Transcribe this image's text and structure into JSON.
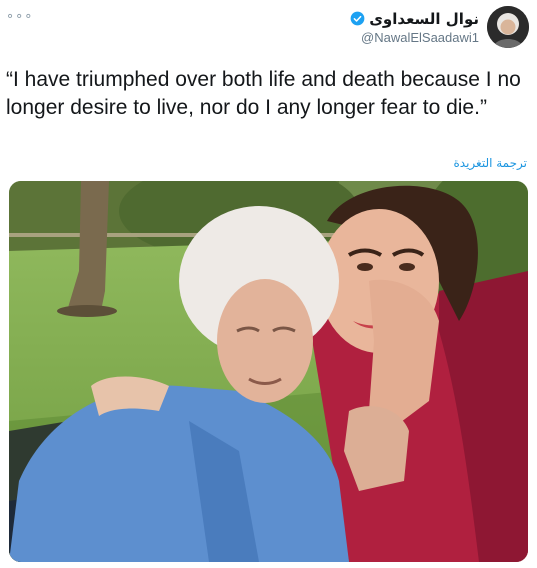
{
  "tweet": {
    "more_label": "∘∘∘",
    "author": {
      "display_name": "نوال السعداوى",
      "handle": "@NawalElSaadawi1",
      "verified": true,
      "avatar_icon": "profile-photo"
    },
    "text": "“I have triumphed over both life and death because I no longer desire to live, nor do I any longer fear to die.”",
    "translate_label": "ترجمة التغريدة",
    "media": {
      "type": "photo"
    },
    "colors": {
      "link": "#1b95e0",
      "verified_badge": "#1da1f2",
      "secondary_text": "#657786"
    }
  }
}
